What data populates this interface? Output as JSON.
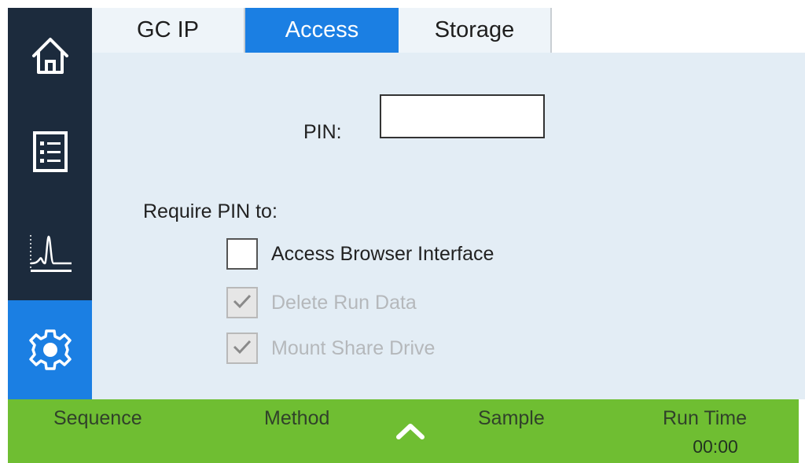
{
  "tabs": [
    {
      "label": "GC IP",
      "active": false
    },
    {
      "label": "Access",
      "active": true
    },
    {
      "label": "Storage",
      "active": false
    }
  ],
  "sidebar": {
    "items": [
      {
        "icon": "home-icon",
        "active": false
      },
      {
        "icon": "list-icon",
        "active": false
      },
      {
        "icon": "chromatogram-icon",
        "active": false
      },
      {
        "icon": "gear-icon",
        "active": true
      }
    ]
  },
  "access": {
    "pin_label": "PIN:",
    "pin_value": "",
    "require_label": "Require PIN to:",
    "options": [
      {
        "label": "Access Browser Interface",
        "checked": false,
        "disabled": false
      },
      {
        "label": "Delete Run Data",
        "checked": true,
        "disabled": true
      },
      {
        "label": "Mount Share Drive",
        "checked": true,
        "disabled": true
      }
    ]
  },
  "status_bar": {
    "sequence_label": "Sequence",
    "method_label": "Method",
    "sample_label": "Sample",
    "run_time_label": "Run Time",
    "run_time_value": "00:00"
  },
  "colors": {
    "accent": "#1b7fe3",
    "sidebar": "#1c2b3d",
    "content_bg": "#e3edf5",
    "status_bar": "#6fbe32"
  }
}
